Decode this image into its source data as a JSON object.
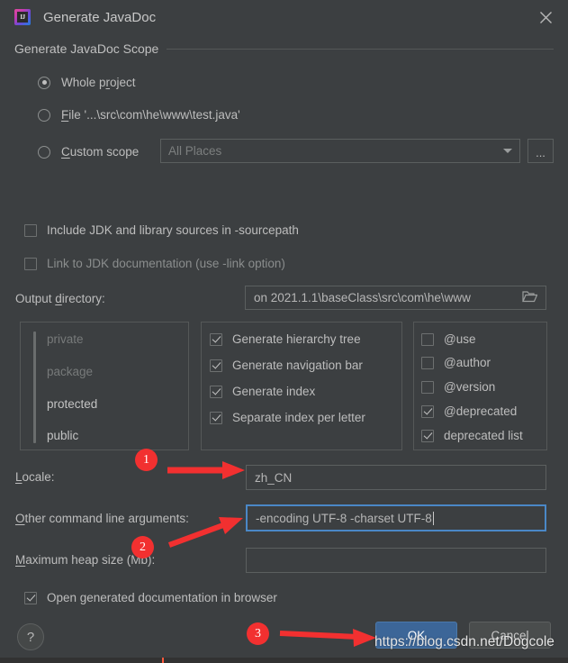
{
  "window": {
    "title": "Generate JavaDoc",
    "app_icon": "intellij-idea-icon",
    "close_icon": "close-icon"
  },
  "scope": {
    "group_label": "Generate JavaDoc Scope",
    "options": [
      {
        "label": "Whole project",
        "selected": true
      },
      {
        "label": "File '...\\src\\com\\he\\www\\test.java'",
        "selected": false
      },
      {
        "label": "Custom scope",
        "selected": false
      }
    ],
    "custom_scope_value": "All Places",
    "browse_label": "...",
    "dropdown_icon": "chevron-down-icon"
  },
  "sources": {
    "include_jdk": {
      "label": "Include JDK and library sources in -sourcepath",
      "checked": false
    },
    "link_jdk": {
      "label": "Link to JDK documentation (use -link option)",
      "checked": false
    }
  },
  "output": {
    "label": "Output directory:",
    "value": "on 2021.1.1\\baseClass\\src\\com\\he\\www",
    "browse_icon": "folder-icon"
  },
  "visibility": {
    "levels": [
      "private",
      "package",
      "protected",
      "public"
    ],
    "selected": "protected"
  },
  "generate_options": [
    {
      "label": "Generate hierarchy tree",
      "checked": true
    },
    {
      "label": "Generate navigation bar",
      "checked": true
    },
    {
      "label": "Generate index",
      "checked": true
    },
    {
      "label": "Separate index per letter",
      "checked": true
    }
  ],
  "tag_options": [
    {
      "label": "@use",
      "checked": false
    },
    {
      "label": "@author",
      "checked": false
    },
    {
      "label": "@version",
      "checked": false
    },
    {
      "label": "@deprecated",
      "checked": true
    },
    {
      "label": "deprecated list",
      "checked": true
    }
  ],
  "locale": {
    "label": "Locale:",
    "value": "zh_CN"
  },
  "other_args": {
    "label": "Other command line arguments:",
    "value": "-encoding UTF-8 -charset UTF-8",
    "focused": true
  },
  "heap": {
    "label": "Maximum heap size (Mb):",
    "value": ""
  },
  "open_browser": {
    "label": "Open generated documentation in browser",
    "checked": true
  },
  "footer": {
    "help_label": "?",
    "ok_label": "OK",
    "cancel_label": "Cancel"
  },
  "annotations": {
    "markers": [
      "1",
      "2",
      "3"
    ],
    "watermark": "https://blog.csdn.net/Dogcole",
    "color": "#f23030"
  }
}
